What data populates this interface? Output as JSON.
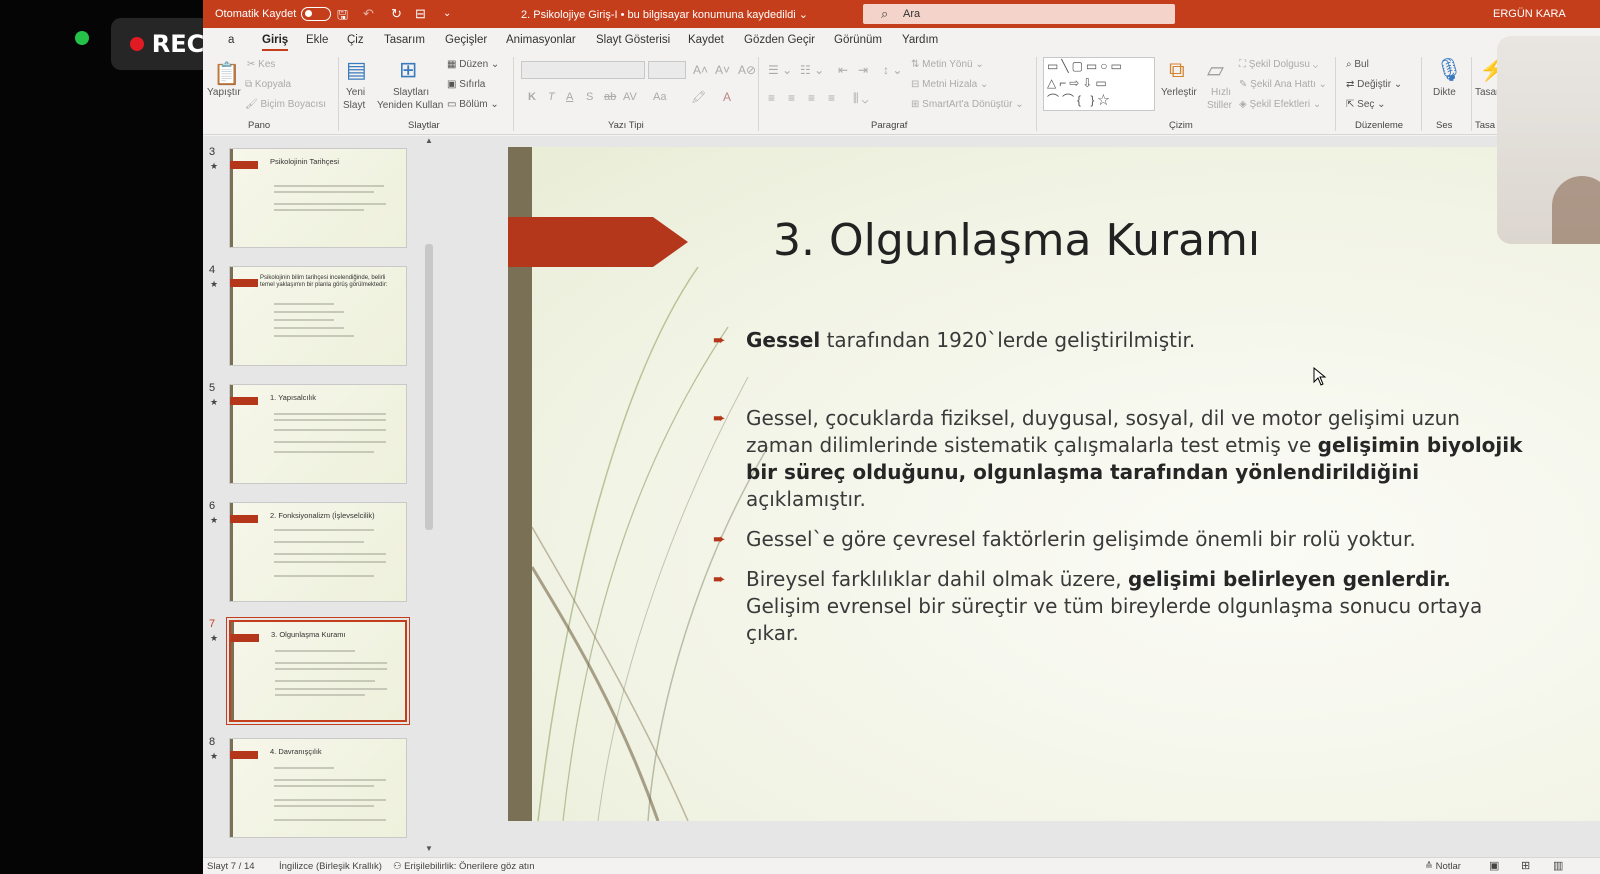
{
  "recording": {
    "label": "REC"
  },
  "titlebar": {
    "autosave_label": "Otomatik Kaydet",
    "doc_title": "2. Psikolojiye Giriş-I • bu bilgisayar konumuna kaydedildi ⌄",
    "search_placeholder": "Ara",
    "user": "ERGÜN KARA"
  },
  "menu": {
    "items": [
      "a",
      "Giriş",
      "Ekle",
      "Çiz",
      "Tasarım",
      "Geçişler",
      "Animasyonlar",
      "Slayt Gösterisi",
      "Kaydet",
      "Gözden Geçir",
      "Görünüm",
      "Yardım"
    ],
    "active": "Giriş"
  },
  "ribbon": {
    "pano": {
      "paste": "Yapıştır",
      "cut": "Kes",
      "copy": "Kopyala",
      "format_painter": "Biçim Boyacısı",
      "group": "Pano"
    },
    "slaytlar": {
      "new_slide_1": "Yeni",
      "new_slide_2": "Slayt",
      "reuse_1": "Slaytları",
      "reuse_2": "Yeniden Kullan",
      "layout": "Düzen",
      "reset": "Sıfırla",
      "section": "Bölüm",
      "group": "Slaytlar"
    },
    "font": {
      "group": "Yazı Tipi",
      "bold": "K",
      "italic": "T",
      "underline": "A",
      "strike": "S",
      "spacing": "AV",
      "case": "Aa"
    },
    "paragraph": {
      "text_dir": "Metin Yönü",
      "align_text": "Metni Hizala",
      "smartart": "SmartArt'a Dönüştür",
      "group": "Paragraf"
    },
    "drawing": {
      "arrange": "Yerleştir",
      "quick_1": "Hızlı",
      "quick_2": "Stiller",
      "fill": "Şekil Dolgusu",
      "outline": "Şekil Ana Hattı",
      "effects": "Şekil Efektleri",
      "group": "Çizim"
    },
    "editing": {
      "find": "Bul",
      "replace": "Değiştir",
      "select": "Seç",
      "group": "Düzenleme"
    },
    "voice": {
      "dictate": "Dikte",
      "group": "Ses"
    },
    "designer": {
      "label": "Tasar",
      "group": "Tasa"
    }
  },
  "thumbnails": [
    {
      "num": "3",
      "title": "Psikolojinin Tarihçesi",
      "selected": false
    },
    {
      "num": "4",
      "title": "Psikolojinin bilim tarihçesi incelendiğinde, belirli temel yaklaşımın bir planla görüş görülmektedir:",
      "selected": false
    },
    {
      "num": "5",
      "title": "1. Yapısalcılık",
      "selected": false
    },
    {
      "num": "6",
      "title": "2. Fonksiyonalizm (İşlevselcilik)",
      "selected": false
    },
    {
      "num": "7",
      "title": "3. Olgunlaşma Kuramı",
      "selected": true
    },
    {
      "num": "8",
      "title": "4. Davranışçılık",
      "selected": false
    }
  ],
  "slide": {
    "title": "3. Olgunlaşma Kuramı",
    "b1": {
      "bold": "Gessel",
      "rest": " tarafından 1920`lerde geliştirilmiştir."
    },
    "b2": {
      "pre": "Gessel, çocuklarda fiziksel, duygusal, sosyal, dil ve motor gelişimi uzun zaman dilimlerinde sistematik çalışmalarla test etmiş ve ",
      "bold": "gelişimin biyolojik bir süreç olduğunu, olgunlaşma tarafından yönlendirildiğini",
      "post": " açıklamıştır."
    },
    "b3": {
      "text": "Gessel`e göre çevresel faktörlerin gelişimde önemli bir rolü yoktur."
    },
    "b4": {
      "pre": "Bireysel farklılıklar dahil olmak üzere, ",
      "bold": "gelişimi belirleyen genlerdir.",
      "post": " Gelişim evrensel bir süreçtir ve tüm bireylerde olgunlaşma sonucu ortaya çıkar."
    }
  },
  "statusbar": {
    "slide": "Slayt 7 / 14",
    "language": "İngilizce (Birleşik Krallık)",
    "accessibility": "Erişilebilirlik: Önerilere göz atın",
    "notes": "Notlar"
  },
  "colors": {
    "accent": "#c43e1c",
    "slide_bar": "#7a7055",
    "banner": "#b5371b"
  }
}
